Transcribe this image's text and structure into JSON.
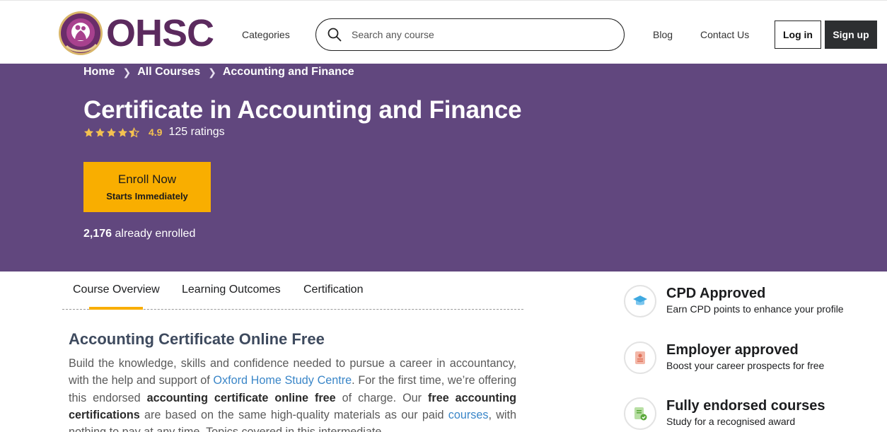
{
  "header": {
    "logo_text": "OHSC",
    "categories_label": "Categories",
    "search_placeholder": "Search any course",
    "blog_label": "Blog",
    "contact_label": "Contact Us",
    "login_label": "Log in",
    "signup_label": "Sign up"
  },
  "breadcrumb": [
    "Home",
    "All Courses",
    "Accounting and Finance"
  ],
  "course": {
    "title": "Certificate in Accounting and Finance",
    "rating_value": "4.9",
    "rating_stars": 4.5,
    "rating_count": "125 ratings",
    "enroll_label": "Enroll Now",
    "enroll_sublabel": "Starts Immediately",
    "enrolled_count": "2,176",
    "enrolled_suffix": " already enrolled"
  },
  "tabs": [
    {
      "label": "Course Overview",
      "active": true
    },
    {
      "label": "Learning Outcomes",
      "active": false
    },
    {
      "label": "Certification",
      "active": false
    }
  ],
  "content": {
    "section_title": "Accounting Certificate Online Free",
    "p_1": "Build the knowledge, skills and confidence needed to pursue a career in accountancy, with the help and support of ",
    "p_link_1": "Oxford Home Study Centre",
    "p_2": ".  For the first time, we’re offering this endorsed ",
    "p_bold_1": "accounting certificate online free",
    "p_3": " of charge. Our ",
    "p_bold_2": "free accounting certifications",
    "p_4": " are based on the same high-quality materials as our paid ",
    "p_link_2": "courses",
    "p_5": ", with nothing to pay at any time.  Topics covered in this intermediate"
  },
  "features": [
    {
      "icon": "graduation-cap-icon",
      "title": "CPD Approved",
      "desc": "Earn CPD points to enhance your profile"
    },
    {
      "icon": "id-badge-icon",
      "title": "Employer approved",
      "desc": "Boost your career prospects for free"
    },
    {
      "icon": "certificate-check-icon",
      "title": "Fully endorsed courses",
      "desc": "Study for a recognised award"
    }
  ],
  "colors": {
    "hero_bg": "#61477e",
    "accent": "#f9ae00",
    "star": "#f4c150",
    "link": "#3a86c8",
    "brand": "#5b2a5e"
  }
}
